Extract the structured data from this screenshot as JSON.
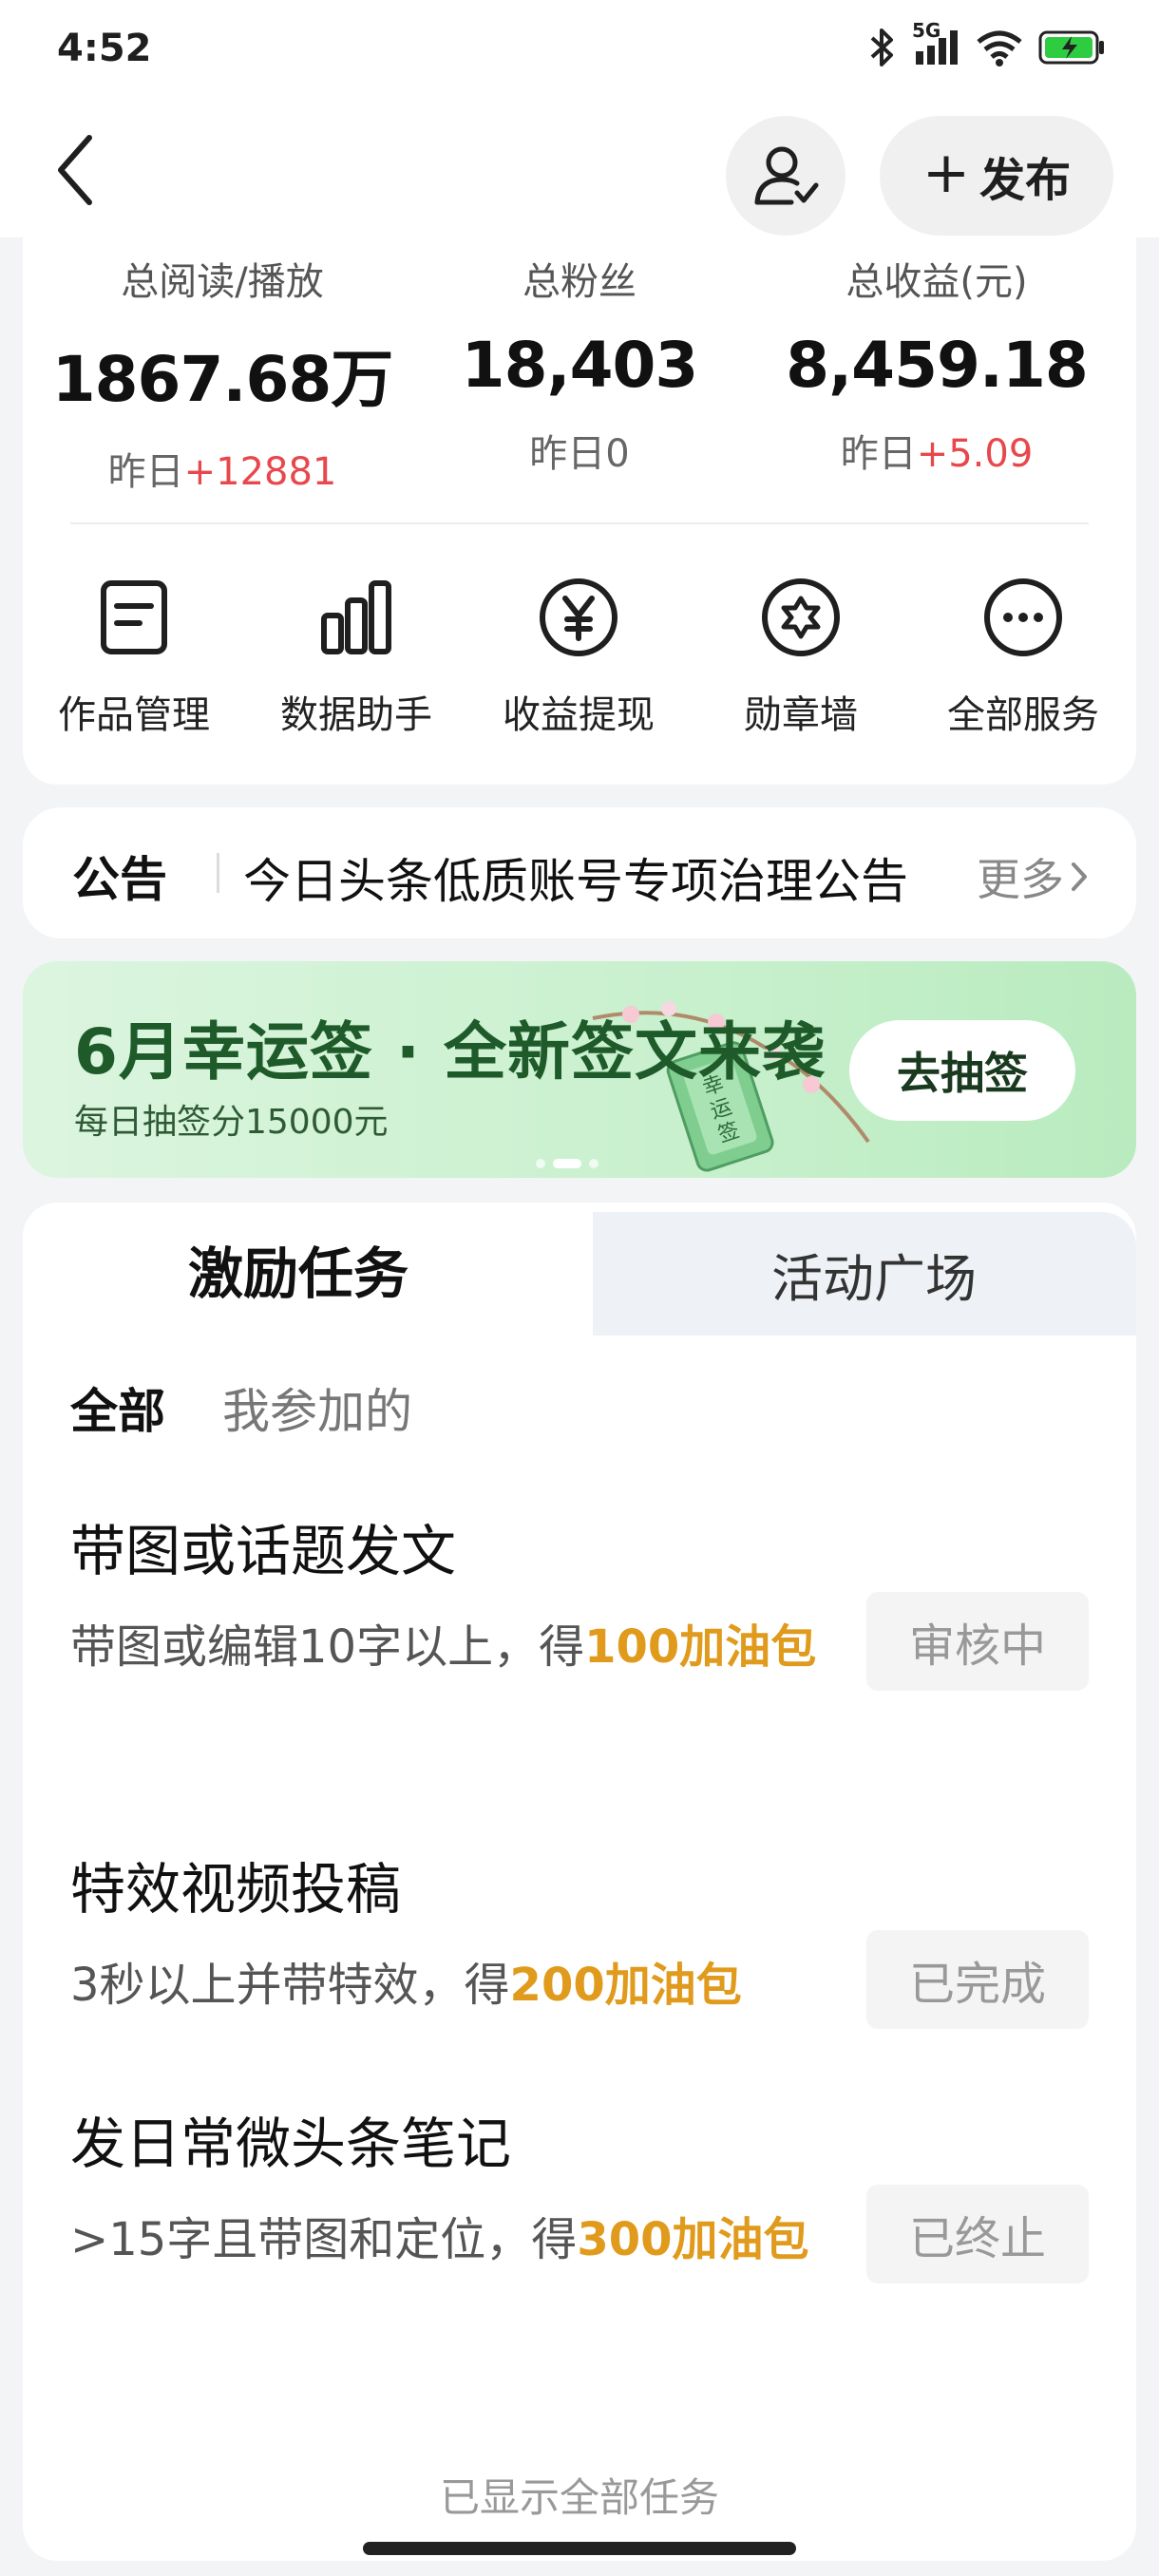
{
  "status_bar": {
    "time": "4:52",
    "network": "5G",
    "icons": [
      "bluetooth-icon",
      "signal-icon",
      "wifi-icon",
      "battery-charging-icon"
    ]
  },
  "nav": {
    "back_icon": "chevron-left-icon",
    "follow_icon": "user-check-icon",
    "publish_label": "发布"
  },
  "stats": [
    {
      "label": "总阅读/播放",
      "value": "1867.68万",
      "sub_prefix": "昨日",
      "sub_value": "+12881"
    },
    {
      "label": "总粉丝",
      "value": "18,403",
      "sub_prefix": "昨日",
      "sub_value": "0"
    },
    {
      "label": "总收益(元)",
      "value": "8,459.18",
      "sub_prefix": "昨日",
      "sub_value": "+5.09"
    }
  ],
  "services": [
    {
      "label": "作品管理",
      "icon": "document-icon"
    },
    {
      "label": "数据助手",
      "icon": "bar-chart-icon"
    },
    {
      "label": "收益提现",
      "icon": "yen-circle-icon"
    },
    {
      "label": "勋章墙",
      "icon": "medal-icon"
    },
    {
      "label": "全部服务",
      "icon": "more-circle-icon"
    }
  ],
  "notice": {
    "tag": "公告",
    "text": "今日头条低质账号专项治理公告",
    "more": "更多"
  },
  "banner": {
    "title": "6月幸运签 · 全新签文来袭",
    "subtitle": "每日抽签分15000元",
    "button": "去抽签",
    "art_text": "幸运签",
    "colors": {
      "title": "#1f5b2a",
      "bg": "#c8f0cd"
    }
  },
  "tasks": {
    "tabs": [
      "激励任务",
      "活动广场"
    ],
    "filters": [
      "全部",
      "我参加的"
    ],
    "items": [
      {
        "title": "带图或话题发文",
        "desc": "带图或编辑10字以上，得",
        "reward": "100加油包",
        "status": "审核中"
      },
      {
        "title": "特效视频投稿",
        "desc": "3秒以上并带特效，得",
        "reward": "200加油包",
        "status": "已完成"
      },
      {
        "title": "发日常微头条笔记",
        "desc": ">15字且带图和定位，得",
        "reward": "300加油包",
        "status": "已终止"
      }
    ],
    "footer": "已显示全部任务"
  },
  "colors": {
    "positive": "#e8474b",
    "reward": "#e09a1c",
    "card_bg": "#ffffff",
    "page_bg": "#f3f4f6"
  }
}
